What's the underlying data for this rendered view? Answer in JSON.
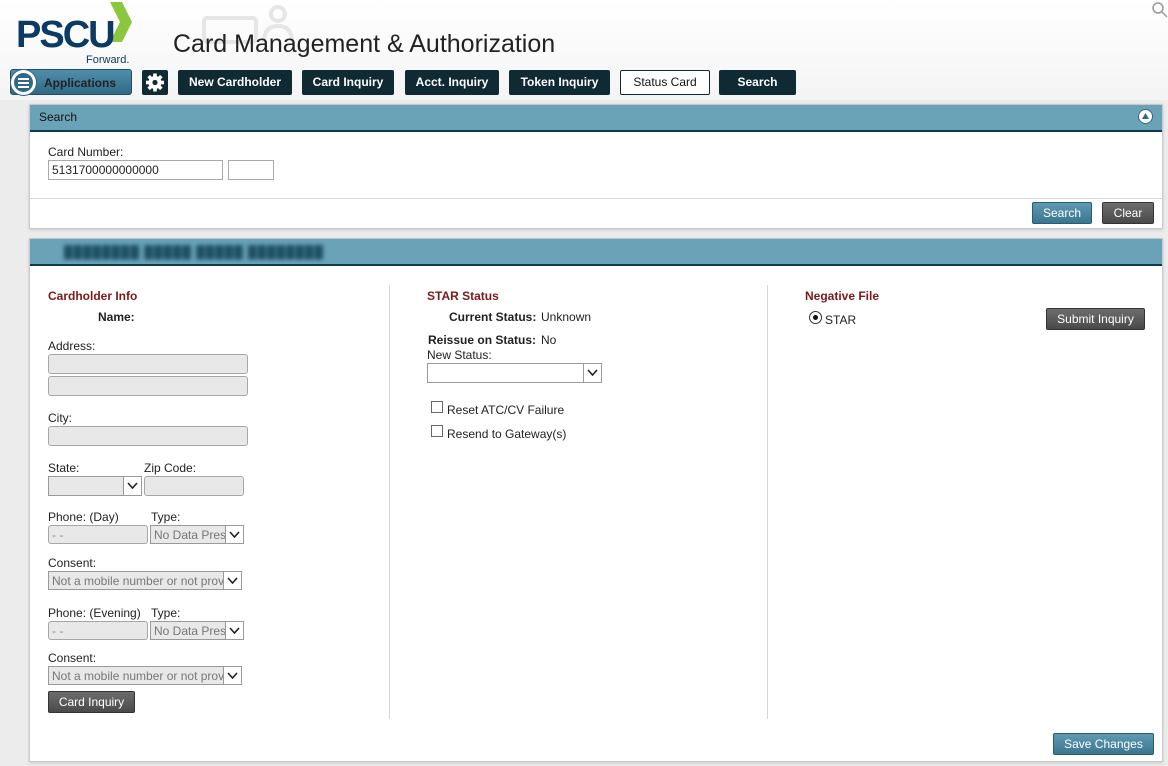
{
  "header": {
    "logo_text": "PSCU",
    "logo_tagline": "Forward.",
    "app_title": "Card Management & Authorization"
  },
  "nav": {
    "applications_label": "Applications",
    "buttons": [
      "New Cardholder",
      "Card Inquiry",
      "Acct. Inquiry",
      "Token Inquiry",
      "Status Card",
      "Search"
    ],
    "active": "Status Card"
  },
  "search_panel": {
    "title": "Search",
    "card_number_label": "Card Number:",
    "card_number_value": "5131700000000000",
    "card_suffix_value": "",
    "search_button": "Search",
    "clear_button": "Clear"
  },
  "detail_panel": {
    "blurred_title": "████████ █████ █████ ████████",
    "cardholder_info": {
      "title": "Cardholder Info",
      "name_label": "Name:",
      "name_value": "",
      "address_label": "Address:",
      "city_label": "City:",
      "state_label": "State:",
      "zip_label": "Zip Code:",
      "phone_day_label": "Phone: (Day)",
      "phone_day_value": "- -",
      "type_label": "Type:",
      "type_day_value": "No Data Present",
      "consent_label": "Consent:",
      "consent_day_value": "Not a mobile number or not provided",
      "phone_evening_label": "Phone: (Evening)",
      "phone_evening_value": "- -",
      "type_evening_value": "No Data Present",
      "consent_evening_value": "Not a mobile number or not provided",
      "card_inquiry_button": "Card Inquiry"
    },
    "star_status": {
      "title": "STAR Status",
      "current_status_label": "Current Status:",
      "current_status_value": "Unknown",
      "reissue_label": "Reissue on Status:",
      "reissue_value": "No",
      "new_status_label": "New Status:",
      "new_status_value": "",
      "reset_atc_label": "Reset ATC/CV Failure",
      "resend_gateway_label": "Resend to Gateway(s)"
    },
    "negative_file": {
      "title": "Negative File",
      "radio_label": "STAR",
      "submit_button": "Submit Inquiry"
    },
    "save_button": "Save Changes"
  }
}
